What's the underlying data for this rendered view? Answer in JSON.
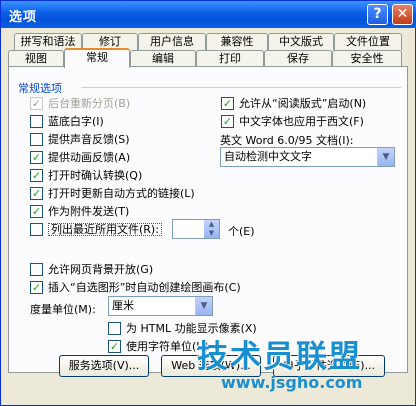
{
  "title": "选项",
  "title_buttons": {
    "help": "?",
    "close": "✕"
  },
  "tabs_row1": [
    "拼写和语法",
    "修订",
    "用户信息",
    "兼容性",
    "中文版式",
    "文件位置"
  ],
  "tabs_row2": [
    "视图",
    "常规",
    "编辑",
    "打印",
    "保存",
    "安全性"
  ],
  "active_tab": "常规",
  "group_title": "常规选项",
  "left_options": [
    {
      "label": "后台重新分页(B)",
      "checked": true,
      "disabled": true
    },
    {
      "label": "蓝底白字(I)",
      "checked": false
    },
    {
      "label": "提供声音反馈(S)",
      "checked": false
    },
    {
      "label": "提供动画反馈(A)",
      "checked": true
    },
    {
      "label": "打开时确认转换(Q)",
      "checked": true
    },
    {
      "label": "打开时更新自动方式的链接(L)",
      "checked": true
    },
    {
      "label": "作为附件发送(T)",
      "checked": true
    },
    {
      "label": "列出最近所用文件(R):",
      "checked": false
    }
  ],
  "recent_files_suffix": "个(E)",
  "recent_files_count": "",
  "right_options": [
    {
      "label": "允许从“阅读版式”启动(N)",
      "checked": true
    },
    {
      "label": "中文字体也应用于西文(F)",
      "checked": true
    }
  ],
  "word_format_label": "英文 Word 6.0/95 文档(I):",
  "word_format_value": "自动检测中文文字",
  "lower_options": [
    {
      "label": "允许网页背景开放(G)",
      "checked": false
    },
    {
      "label": "插入“自选图形”时自动创建绘图画布(C)",
      "checked": true
    }
  ],
  "measure_unit_label": "度量单位(M):",
  "measure_unit_value": "厘米",
  "sub_options": [
    {
      "label": "为 HTML 功能显示像素(X)",
      "checked": false
    },
    {
      "label": "使用字符单位(H)",
      "checked": true
    }
  ],
  "buttons": {
    "service": "服务选项(V)...",
    "web": "Web 选项(W)...",
    "email": "电子邮件选项(E)..."
  },
  "watermark": "技术员联盟",
  "watermark_url": "www.jsgho.com"
}
